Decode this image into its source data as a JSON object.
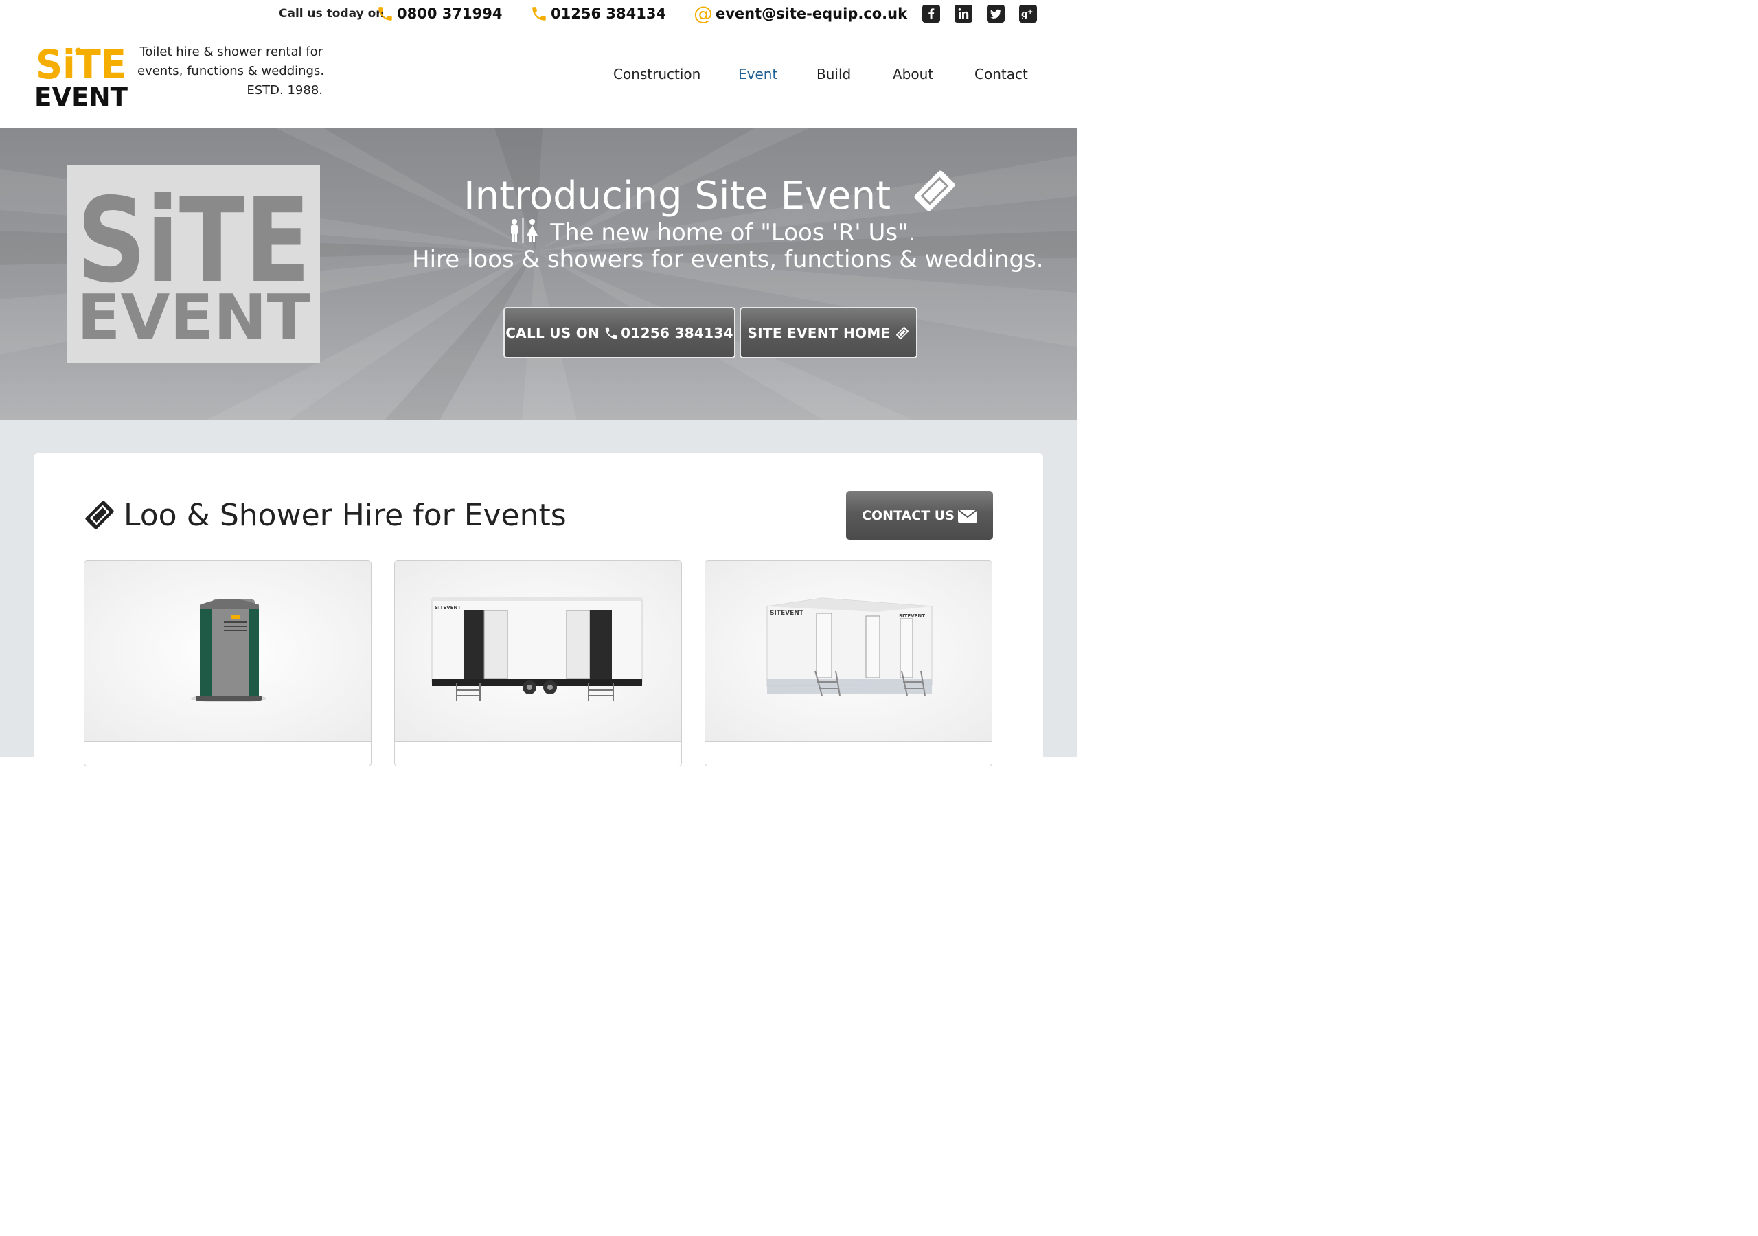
{
  "topbar": {
    "call_label": "Call us today on",
    "phone1": "0800 371994",
    "phone2": "01256 384134",
    "email": "event@site-equip.co.uk",
    "social": [
      "facebook-icon",
      "linkedin-icon",
      "twitter-icon",
      "google-plus-icon"
    ],
    "accent": "#f5ad00"
  },
  "header": {
    "logo_top": "SiTE",
    "logo_bottom": "EVENT",
    "tagline": [
      "Toilet hire & shower rental for",
      "events, functions & weddings.",
      "ESTD. 1988."
    ]
  },
  "nav": {
    "items": [
      {
        "label": "Construction"
      },
      {
        "label": "Event",
        "active": true
      },
      {
        "label": "Build"
      },
      {
        "label": "About"
      },
      {
        "label": "Contact"
      }
    ],
    "active_color": "#1f5f92"
  },
  "hero": {
    "logo_top": "SiTE",
    "logo_bottom": "EVENT",
    "title": "Introducing Site Event",
    "subtitle1": "The new home of \"Loos 'R' Us\".",
    "subtitle2": "Hire loos & showers for events, functions & weddings.",
    "btn_call_prefix": "CALL US ON",
    "btn_call_number": "01256 384134",
    "btn_home": "SITE EVENT HOME"
  },
  "section": {
    "title": "Loo & Shower Hire for Events",
    "contact_btn": "CONTACT US",
    "brand_on_units": "SITEVENT"
  },
  "cards": [
    {
      "name": "portable-toilet-unit-image"
    },
    {
      "name": "trailer-toilet-unit-image"
    },
    {
      "name": "luxury-toilet-block-image"
    }
  ]
}
